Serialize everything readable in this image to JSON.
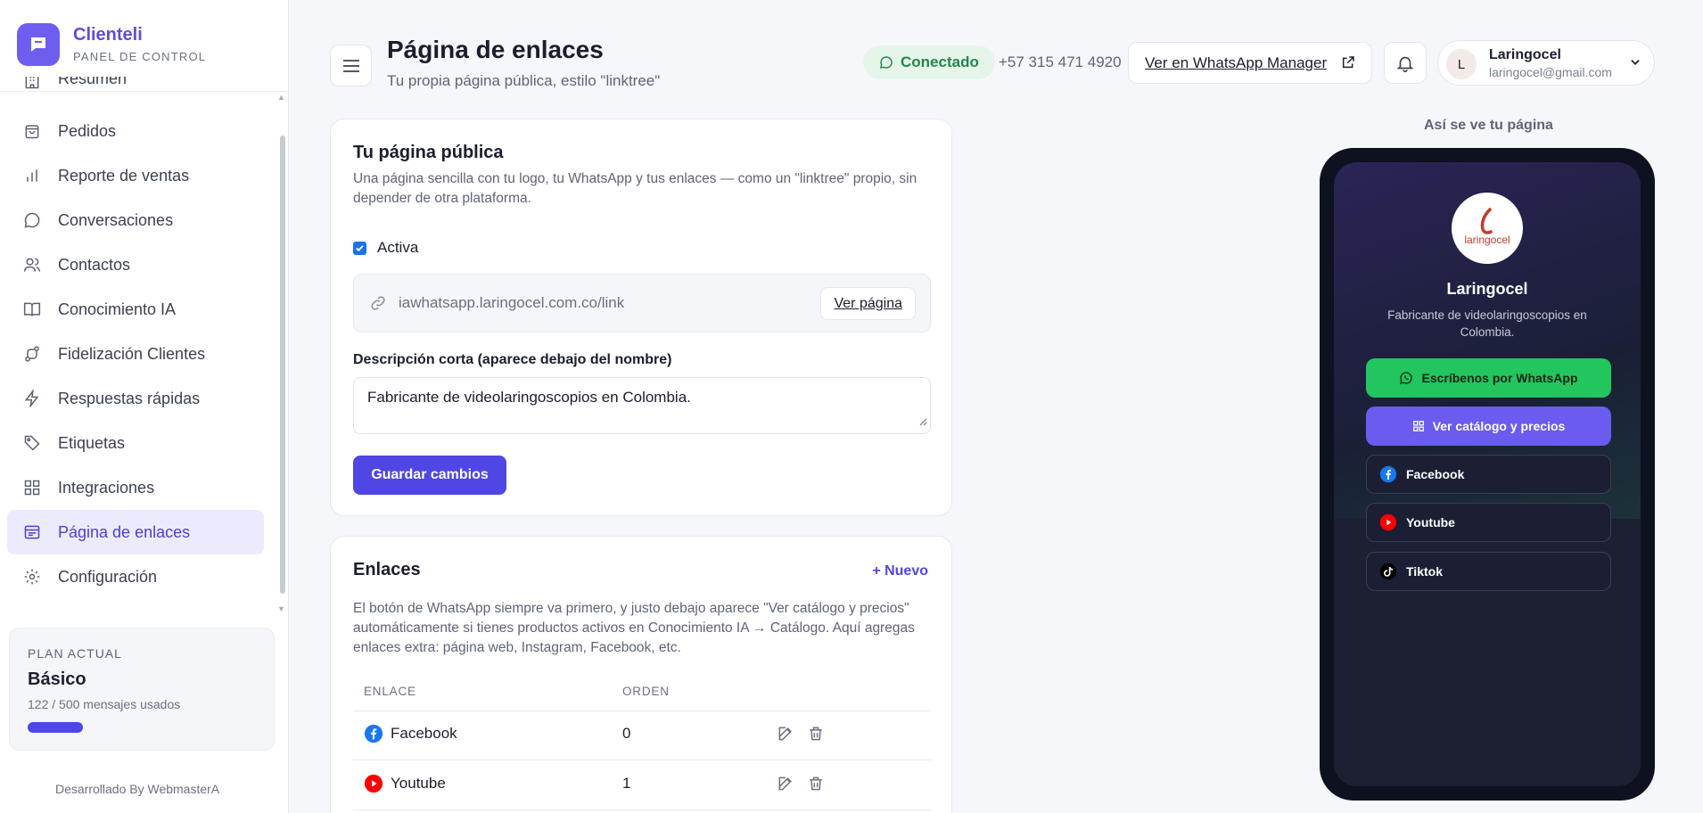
{
  "brand": {
    "name": "Clienteli",
    "subtitle": "PANEL DE CONTROL"
  },
  "sidebar": {
    "items": [
      {
        "label": "Resumen",
        "icon": "building-icon"
      },
      {
        "label": "Pedidos",
        "icon": "bag-icon"
      },
      {
        "label": "Reporte de ventas",
        "icon": "bar-chart-icon"
      },
      {
        "label": "Conversaciones",
        "icon": "chat-bubble-icon"
      },
      {
        "label": "Contactos",
        "icon": "users-icon"
      },
      {
        "label": "Conocimiento IA",
        "icon": "book-icon"
      },
      {
        "label": "Fidelización Clientes",
        "icon": "route-icon"
      },
      {
        "label": "Respuestas rápidas",
        "icon": "bolt-icon"
      },
      {
        "label": "Etiquetas",
        "icon": "tag-icon"
      },
      {
        "label": "Integraciones",
        "icon": "grid-icon"
      },
      {
        "label": "Página de enlaces",
        "icon": "link-page-icon",
        "active": true
      },
      {
        "label": "Configuración",
        "icon": "gear-icon"
      }
    ],
    "plan": {
      "label": "PLAN ACTUAL",
      "name": "Básico",
      "usage": "122 / 500 mensajes usados",
      "used": 122,
      "total": 500
    },
    "footer": "Desarrollado By WebmasterA"
  },
  "header": {
    "title": "Página de enlaces",
    "subtitle": "Tu propia página pública, estilo \"linktree\"",
    "status": "Conectado",
    "phone": "+57 315 471 4920",
    "manager_link": "Ver en WhatsApp Manager",
    "user": {
      "initial": "L",
      "name": "Laringocel",
      "email": "laringocel@gmail.com"
    }
  },
  "public_page": {
    "title": "Tu página pública",
    "description": "Una página sencilla con tu logo, tu WhatsApp y tus enlaces — como un \"linktree\" propio, sin depender de otra plataforma.",
    "active_label": "Activa",
    "active": true,
    "url": "iawhatsapp.laringocel.com.co/link",
    "view_button": "Ver página",
    "desc_label": "Descripción corta (aparece debajo del nombre)",
    "desc_value": "Fabricante de videolaringoscopios en Colombia.",
    "save_button": "Guardar cambios"
  },
  "links_card": {
    "title": "Enlaces",
    "new_button": "+ Nuevo",
    "description": "El botón de WhatsApp siempre va primero, y justo debajo aparece \"Ver catálogo y precios\" automáticamente si tienes productos activos en Conocimiento IA → Catálogo. Aquí agregas enlaces extra: página web, Instagram, Facebook, etc.",
    "columns": [
      "ENLACE",
      "ORDEN"
    ],
    "rows": [
      {
        "name": "Facebook",
        "order": "0",
        "icon": "facebook-icon"
      },
      {
        "name": "Youtube",
        "order": "1",
        "icon": "youtube-icon"
      }
    ]
  },
  "preview": {
    "label": "Así se ve tu página",
    "logo_text": "laringocel",
    "name": "Laringocel",
    "description": "Fabricante de videolaringoscopios en Colombia.",
    "whatsapp_button": "Escríbenos por WhatsApp",
    "catalog_button": "Ver catálogo y precios",
    "links": [
      {
        "label": "Facebook",
        "icon": "facebook-icon"
      },
      {
        "label": "Youtube",
        "icon": "youtube-icon"
      },
      {
        "label": "Tiktok",
        "icon": "tiktok-icon"
      }
    ]
  },
  "colors": {
    "accent": "#4f46e5",
    "whatsapp": "#22c55e",
    "status_bg": "#e5f5ea",
    "status_text": "#25854a"
  }
}
